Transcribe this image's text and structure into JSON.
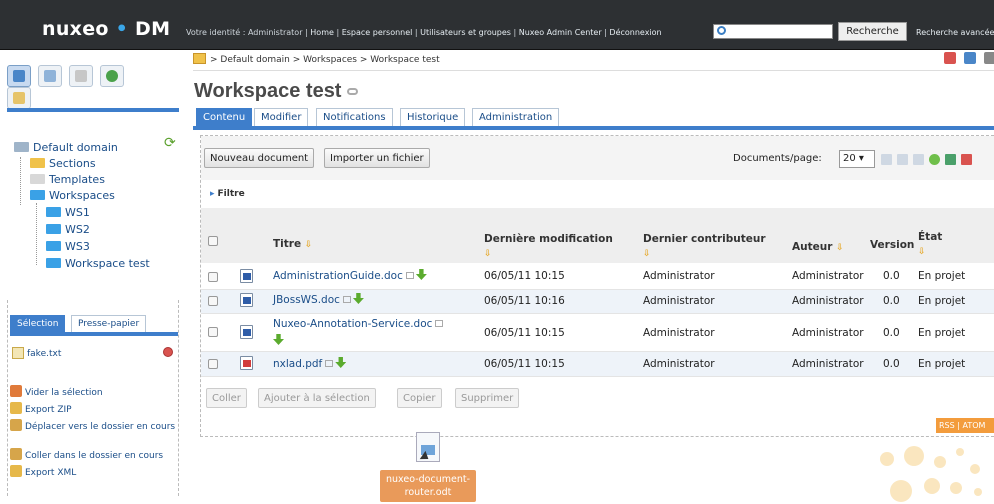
{
  "header": {
    "logo_left": "nuxeo",
    "logo_dot": "•",
    "logo_right": "DM",
    "identity_text": "Votre identité : Administrator",
    "links": [
      "Home",
      "Espace personnel",
      "Utilisateurs et groupes",
      "Nuxeo Admin Center",
      "Déconnexion"
    ],
    "search_value": "",
    "search_button": "Recherche",
    "advanced_search": "Recherche avancée"
  },
  "sidebar": {
    "tabs": [
      "navigation-icon",
      "search-icon",
      "tag-icon",
      "globe-icon",
      "note-icon"
    ],
    "tree": {
      "root": "Default domain",
      "children": [
        "Sections",
        "Templates",
        "Workspaces"
      ],
      "workspaces": [
        "WS1",
        "WS2",
        "WS3",
        "Workspace test"
      ]
    },
    "selection_tabs": [
      "Sélection",
      "Presse-papier"
    ],
    "selection_items": [
      "fake.txt"
    ],
    "actions": [
      "Vider la sélection",
      "Export ZIP",
      "Déplacer vers le dossier en cours",
      "Coller dans le dossier en cours",
      "Export XML"
    ]
  },
  "main": {
    "breadcrumb": "> Default domain > Workspaces > Workspace test",
    "title": "Workspace test",
    "tabs": [
      "Contenu",
      "Modifier",
      "Notifications",
      "Historique",
      "Administration"
    ],
    "buttons": {
      "new_doc": "Nouveau document",
      "import": "Importer un fichier"
    },
    "docs_per_page_label": "Documents/page:",
    "docs_per_page_value": "20 ▾",
    "filter": "Filtre",
    "columns": {
      "title": "Titre",
      "modified": "Dernière modification",
      "contributor": "Dernier contributeur",
      "author": "Auteur",
      "version": "Version",
      "state": "État"
    },
    "rows": [
      {
        "title": "AdministrationGuide.doc",
        "modified": "06/05/11 10:15",
        "contributor": "Administrator",
        "author": "Administrator",
        "version": "0.0",
        "state": "En projet"
      },
      {
        "title": "JBossWS.doc",
        "modified": "06/05/11 10:16",
        "contributor": "Administrator",
        "author": "Administrator",
        "version": "0.0",
        "state": "En projet"
      },
      {
        "title": "Nuxeo-Annotation-Service.doc",
        "modified": "06/05/11 10:15",
        "contributor": "Administrator",
        "author": "Administrator",
        "version": "0.0",
        "state": "En projet"
      },
      {
        "title": "nxlad.pdf",
        "modified": "06/05/11 10:15",
        "contributor": "Administrator",
        "author": "Administrator",
        "version": "0.0",
        "state": "En projet"
      }
    ],
    "bottom_buttons": [
      "Coller",
      "Ajouter à la sélection",
      "Copier",
      "Supprimer"
    ],
    "rss": "RSS | ATOM"
  },
  "drag": {
    "label": "nuxeo-document-router.odt"
  },
  "colors": {
    "accent": "#3e7ecb",
    "topbar": "#2d3033",
    "link": "#1a4d88",
    "drag_label": "#e99a5a"
  }
}
